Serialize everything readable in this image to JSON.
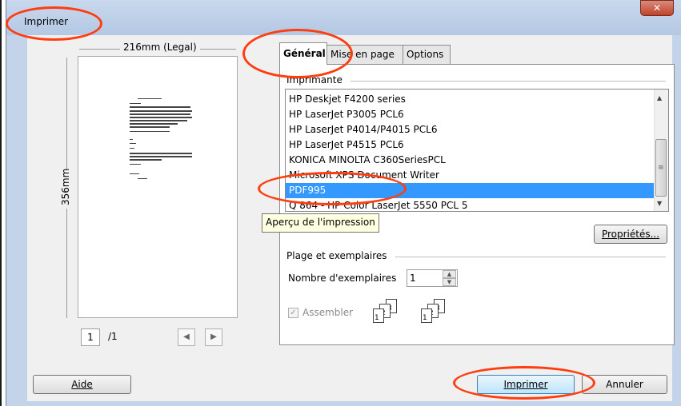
{
  "window": {
    "title": "Imprimer",
    "close_glyph": "✕"
  },
  "preview": {
    "width_label": "216mm (Legal)",
    "height_label": "356mm",
    "page_current": "1",
    "page_total": "/1",
    "prev_glyph": "◀",
    "next_glyph": "▶",
    "tooltip": "Aperçu de l'impression"
  },
  "tabs": [
    {
      "label": "Général",
      "active": true
    },
    {
      "label": "Mise en page",
      "active": false
    },
    {
      "label": "Options",
      "active": false
    }
  ],
  "printer_group": {
    "label": "Imprimante",
    "printers": [
      "HP Deskjet F4200 series",
      "HP LaserJet P3005 PCL6",
      "HP LaserJet P4014/P4015 PCL6",
      "HP LaserJet P4515 PCL6",
      "KONICA MINOLTA C360SeriesPCL",
      "Microsoft XPS Document Writer",
      "PDF995",
      "Q 864 - HP Color LaserJet 5550 PCL 5"
    ],
    "selected": "PDF995",
    "properties_button": "Propriétés..."
  },
  "copies_group": {
    "label": "Plage et exemplaires",
    "copies_label": "Nombre d'exemplaires",
    "copies_value": "1",
    "collate_label": "Assembler",
    "collate_checked": true,
    "collate_pages_a": [
      "1",
      "2",
      "3"
    ],
    "collate_pages_b": [
      "1",
      "2",
      "3"
    ]
  },
  "buttons": {
    "help": "Aide",
    "print": "Imprimer",
    "cancel": "Annuler"
  },
  "colors": {
    "annotation": "#ff3d0f",
    "selection": "#3399ff",
    "titlebar": "#c9d8ed"
  }
}
